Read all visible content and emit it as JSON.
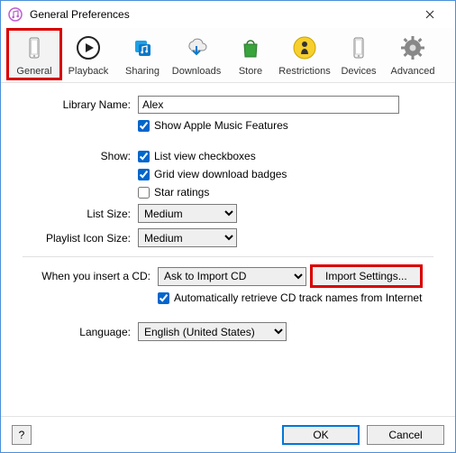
{
  "window": {
    "title": "General Preferences"
  },
  "toolbar": {
    "tabs": [
      {
        "label": "General",
        "icon": "device-icon"
      },
      {
        "label": "Playback",
        "icon": "play-icon"
      },
      {
        "label": "Sharing",
        "icon": "music-share-icon"
      },
      {
        "label": "Downloads",
        "icon": "cloud-download-icon"
      },
      {
        "label": "Store",
        "icon": "bag-icon"
      },
      {
        "label": "Restrictions",
        "icon": "restrictions-icon"
      },
      {
        "label": "Devices",
        "icon": "phone-icon"
      },
      {
        "label": "Advanced",
        "icon": "gear-icon"
      }
    ],
    "selected_index": 0
  },
  "general": {
    "library_name_label": "Library Name:",
    "library_name_value": "Alex",
    "show_apple_music_label": "Show Apple Music Features",
    "show_apple_music_checked": true,
    "show_label": "Show:",
    "list_view_checkboxes_label": "List view checkboxes",
    "list_view_checkboxes_checked": true,
    "grid_view_badges_label": "Grid view download badges",
    "grid_view_badges_checked": true,
    "star_ratings_label": "Star ratings",
    "star_ratings_checked": false,
    "list_size_label": "List Size:",
    "list_size_value": "Medium",
    "playlist_icon_size_label": "Playlist Icon Size:",
    "playlist_icon_size_value": "Medium",
    "insert_cd_label": "When you insert a CD:",
    "insert_cd_value": "Ask to Import CD",
    "import_settings_label": "Import Settings...",
    "auto_retrieve_label": "Automatically retrieve CD track names from Internet",
    "auto_retrieve_checked": true,
    "language_label": "Language:",
    "language_value": "English (United States)"
  },
  "footer": {
    "help_label": "?",
    "ok_label": "OK",
    "cancel_label": "Cancel"
  }
}
